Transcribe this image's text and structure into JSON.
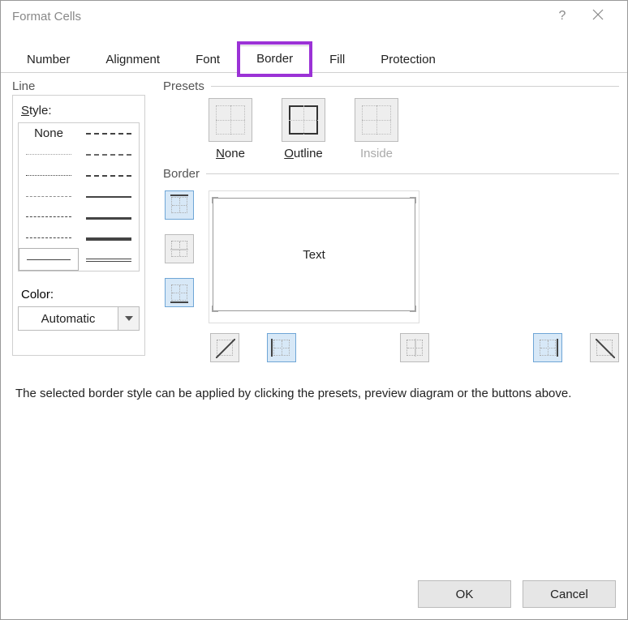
{
  "window": {
    "title": "Format Cells",
    "help_icon": "?",
    "close_icon": "close-icon"
  },
  "tabs": {
    "number": "Number",
    "alignment": "Alignment",
    "font": "Font",
    "border": "Border",
    "fill": "Fill",
    "protection": "Protection",
    "active": "border"
  },
  "line": {
    "group_label": "Line",
    "style_label_prefix": "S",
    "style_label_rest": "tyle:",
    "none_text": "None",
    "color_label": "Color:",
    "color_value": "Automatic"
  },
  "presets": {
    "group_label": "Presets",
    "none_u": "N",
    "none_rest": "one",
    "outline_u": "O",
    "outline_rest": "utline",
    "inside_label": "Inside"
  },
  "border": {
    "group_label": "Border",
    "preview_text": "Text"
  },
  "hint": "The selected border style can be applied by clicking the presets, preview diagram or the buttons above.",
  "footer": {
    "ok": "OK",
    "cancel": "Cancel"
  }
}
